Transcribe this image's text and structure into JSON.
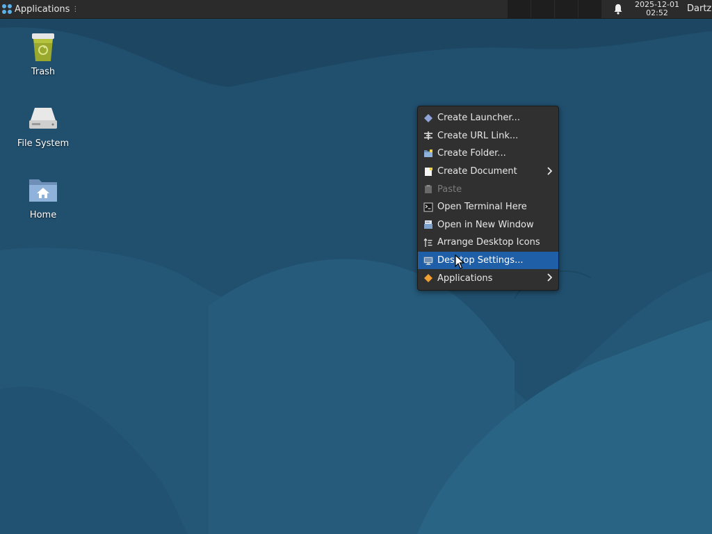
{
  "panel": {
    "applications_label": "Applications",
    "clock_date": "2025-12-01",
    "clock_time": "02:52",
    "user_label": "Dartz"
  },
  "desktop_icons": [
    {
      "label": "Trash",
      "icon": "trash-icon"
    },
    {
      "label": "File System",
      "icon": "drive-icon"
    },
    {
      "label": "Home",
      "icon": "home-folder-icon"
    }
  ],
  "context_menu": {
    "items": [
      {
        "label": "Create Launcher...",
        "icon": "launcher-icon",
        "enabled": true,
        "submenu": false
      },
      {
        "label": "Create URL Link...",
        "icon": "link-icon",
        "enabled": true,
        "submenu": false
      },
      {
        "label": "Create Folder...",
        "icon": "folder-new-icon",
        "enabled": true,
        "submenu": false
      },
      {
        "label": "Create Document",
        "icon": "document-new-icon",
        "enabled": true,
        "submenu": true
      },
      {
        "label": "Paste",
        "icon": "paste-icon",
        "enabled": false,
        "submenu": false
      },
      {
        "label": "Open Terminal Here",
        "icon": "terminal-icon",
        "enabled": true,
        "submenu": false
      },
      {
        "label": "Open in New Window",
        "icon": "file-manager-icon",
        "enabled": true,
        "submenu": false
      },
      {
        "label": "Arrange Desktop Icons",
        "icon": "arrange-icon",
        "enabled": true,
        "submenu": false
      },
      {
        "label": "Desktop Settings...",
        "icon": "desktop-settings-icon",
        "enabled": true,
        "submenu": false,
        "selected": true
      },
      {
        "label": "Applications",
        "icon": "applications-icon",
        "enabled": true,
        "submenu": true
      }
    ]
  },
  "colors": {
    "panel_bg": "#2b2b2b",
    "menu_bg": "#303030",
    "menu_selected": "#1f5fa8",
    "wallpaper_base": "#1f4c6b"
  }
}
